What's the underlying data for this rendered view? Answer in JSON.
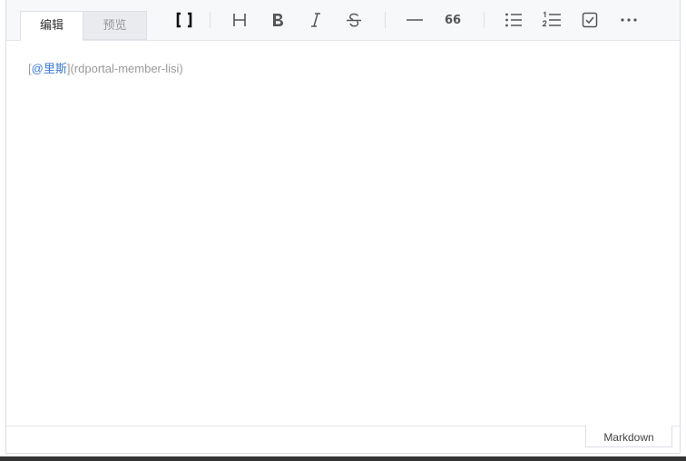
{
  "tabs": {
    "edit_label": "编辑",
    "preview_label": "预览"
  },
  "toolbar": {
    "buttons": [
      {
        "name": "brackets-icon",
        "tooltip": ""
      },
      {
        "name": "heading-icon"
      },
      {
        "name": "bold-icon"
      },
      {
        "name": "italic-icon"
      },
      {
        "name": "strikethrough-icon"
      },
      {
        "name": "horizontal-rule-icon"
      },
      {
        "name": "quote-icon"
      },
      {
        "name": "bullet-list-icon"
      },
      {
        "name": "ordered-list-icon"
      },
      {
        "name": "checkbox-icon"
      },
      {
        "name": "more-icon"
      }
    ],
    "quote_glyph": "66"
  },
  "content": {
    "open_bracket": "[",
    "mention_name": "@里斯",
    "close_bracket": "]",
    "open_paren": "(",
    "mention_id": "rdportal-member-lisi",
    "close_paren": ")"
  },
  "footer": {
    "mode_label": "Markdown"
  },
  "colors": {
    "mention": "#3a7bd5",
    "muted_text": "#9a9a9a",
    "toolbar_bg": "#f7f8fa"
  }
}
